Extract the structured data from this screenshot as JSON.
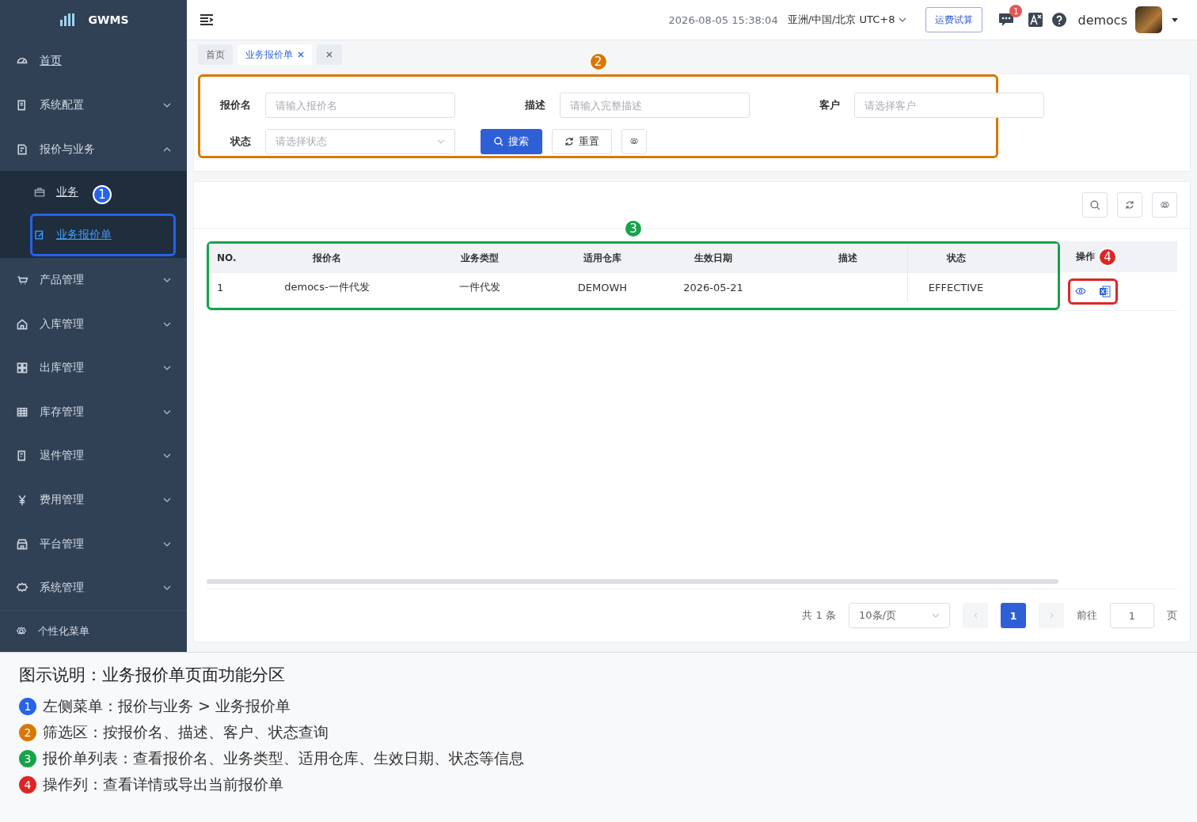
{
  "sidebar": {
    "logo": "GWMS",
    "items": [
      {
        "label": "首页",
        "kind": "link"
      },
      {
        "label": "系统配置",
        "kind": "group",
        "expanded": false
      },
      {
        "label": "报价与业务",
        "kind": "group",
        "expanded": true,
        "children": [
          {
            "label": "业务",
            "selected": false
          },
          {
            "label": "业务报价单",
            "selected": true,
            "annotation": {
              "number": "1",
              "color": "#2563eb"
            }
          }
        ]
      },
      {
        "label": "产品管理",
        "kind": "group",
        "expanded": false
      },
      {
        "label": "入库管理",
        "kind": "group",
        "expanded": false
      },
      {
        "label": "出库管理",
        "kind": "group",
        "expanded": false
      },
      {
        "label": "库存管理",
        "kind": "group",
        "expanded": false
      },
      {
        "label": "退件管理",
        "kind": "group",
        "expanded": false
      },
      {
        "label": "费用管理",
        "kind": "group",
        "expanded": false
      },
      {
        "label": "平台管理",
        "kind": "group",
        "expanded": false
      },
      {
        "label": "系统管理",
        "kind": "group",
        "expanded": false
      }
    ],
    "footer": "个性化菜单"
  },
  "header": {
    "datetime": "2026-08-05 15:38:04",
    "timezone": "亚洲/中国/北京 UTC+8",
    "button": "运费试算",
    "message_count": "1",
    "user": "democs"
  },
  "tabs": [
    {
      "label": "首页",
      "selected": false,
      "closable": false
    },
    {
      "label": "业务报价单",
      "selected": true,
      "closable": true
    }
  ],
  "filter": {
    "annotation": {
      "number": "2",
      "color": "#d97706"
    },
    "fields": [
      {
        "label": "报价名",
        "placeholder": "请输入报价名",
        "kind": "input"
      },
      {
        "label": "描述",
        "placeholder": "请输入完整描述",
        "kind": "input"
      },
      {
        "label": "客户",
        "placeholder": "请选择客户",
        "kind": "input"
      },
      {
        "label": "状态",
        "placeholder": "请选择状态",
        "kind": "select"
      }
    ],
    "search_button": "搜索",
    "reset_button": "重置"
  },
  "table": {
    "annotation": {
      "number": "3",
      "color": "#16a34a"
    },
    "columns": [
      "NO.",
      "报价名",
      "业务类型",
      "适用仓库",
      "生效日期",
      "描述",
      "状态"
    ],
    "action_column": "操作",
    "action_annotation": {
      "number": "4",
      "color": "#dc2626"
    },
    "rows": [
      {
        "no": "1",
        "name": "democs-一件代发",
        "type": "一件代发",
        "warehouse": "DEMOWH",
        "date": "2026-05-21",
        "status": "EFFECTIVE"
      }
    ]
  },
  "pagination": {
    "total": "共 1 条",
    "page_size": "10条/页",
    "pages": [
      {
        "label": "1",
        "selected": true
      }
    ],
    "goto_label": "前往",
    "goto_value": "1",
    "page_suffix": "页"
  },
  "legend": {
    "title": "图示说明：业务报价单页面功能分区",
    "items": [
      {
        "number": "1",
        "color": "#2563eb",
        "text": "左侧菜单：报价与业务 > 业务报价单"
      },
      {
        "number": "2",
        "color": "#d97706",
        "text": "筛选区：按报价名、描述、客户、状态查询"
      },
      {
        "number": "3",
        "color": "#16a34a",
        "text": "报价单列表：查看报价名、业务类型、适用仓库、生效日期、状态等信息"
      },
      {
        "number": "4",
        "color": "#dc2626",
        "text": "操作列：查看详情或导出当前报价单"
      }
    ]
  }
}
